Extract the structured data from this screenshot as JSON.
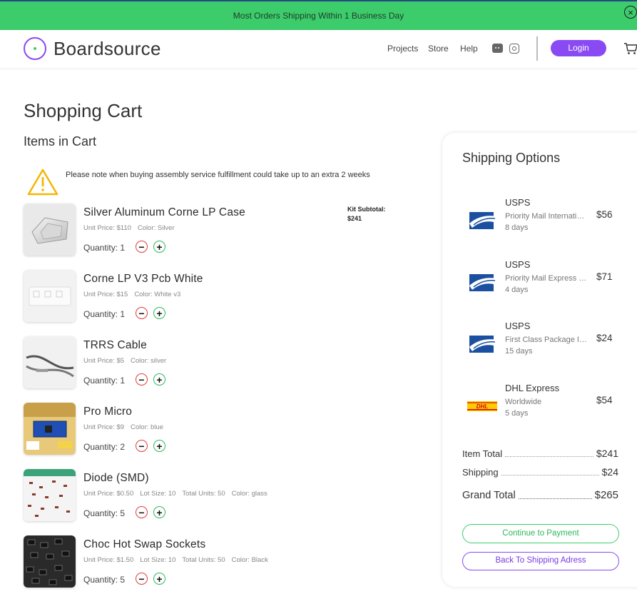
{
  "banner": {
    "text": "Most Orders Shipping Within 1 Business Day",
    "close_icon": "close-circle-icon"
  },
  "header": {
    "brand": "Boardsource",
    "nav": [
      {
        "label": "Projects"
      },
      {
        "label": "Store"
      },
      {
        "label": "Help"
      }
    ],
    "social_icons": [
      "discord-icon",
      "instagram-icon"
    ],
    "login_label": "Login",
    "cart_icon": "cart-icon"
  },
  "page": {
    "title": "Shopping Cart",
    "items_title": "Items in Cart",
    "notice": "Please note when buying assembly service fulfillment could take up to an extra 2 weeks",
    "kit_subtotal_label": "Kit Subtotal:",
    "kit_subtotal_value": "$241"
  },
  "items": [
    {
      "name": "Silver Aluminum Corne LP Case",
      "meta": [
        "Unit Price: $110",
        "Color: Silver"
      ],
      "quantity": "Quantity: 1"
    },
    {
      "name": "Corne LP V3 Pcb White",
      "meta": [
        "Unit Price: $15",
        "Color: White v3"
      ],
      "quantity": "Quantity: 1"
    },
    {
      "name": "TRRS Cable",
      "meta": [
        "Unit Price: $5",
        "Color: silver"
      ],
      "quantity": "Quantity: 1"
    },
    {
      "name": "Pro Micro",
      "meta": [
        "Unit Price: $9",
        "Color: blue"
      ],
      "quantity": "Quantity: 2"
    },
    {
      "name": "Diode (SMD)",
      "meta": [
        "Unit Price: $0.50",
        "Lot Size: 10",
        "Total Units: 50",
        "Color: glass"
      ],
      "quantity": "Quantity: 5"
    },
    {
      "name": "Choc Hot Swap Sockets",
      "meta": [
        "Unit Price: $1.50",
        "Lot Size: 10",
        "Total Units: 50",
        "Color: Black"
      ],
      "quantity": "Quantity: 5"
    }
  ],
  "shipping": {
    "title": "Shipping Options",
    "options": [
      {
        "carrier": "USPS",
        "service": "Priority Mail International",
        "days": "8 days",
        "price": "$56",
        "logo": "usps-logo"
      },
      {
        "carrier": "USPS",
        "service": "Priority Mail Express International",
        "days": "4 days",
        "price": "$71",
        "logo": "usps-logo"
      },
      {
        "carrier": "USPS",
        "service": "First Class Package International",
        "days": "15 days",
        "price": "$24",
        "logo": "usps-logo"
      },
      {
        "carrier": "DHL Express",
        "service": "Worldwide",
        "days": "5 days",
        "price": "$54",
        "logo": "dhl-logo"
      }
    ],
    "item_total_label": "Item Total",
    "item_total": "$241",
    "shipping_label": "Shipping",
    "shipping_total": "$24",
    "grand_total_label": "Grand Total",
    "grand_total": "$265",
    "continue_label": "Continue to Payment",
    "back_label": "Back To Shipping Adress"
  },
  "colors": {
    "banner_green": "#3dcc6c",
    "brand_purple": "#8a4af3",
    "minus_red": "#e23b3b",
    "plus_green": "#2cb85c"
  }
}
